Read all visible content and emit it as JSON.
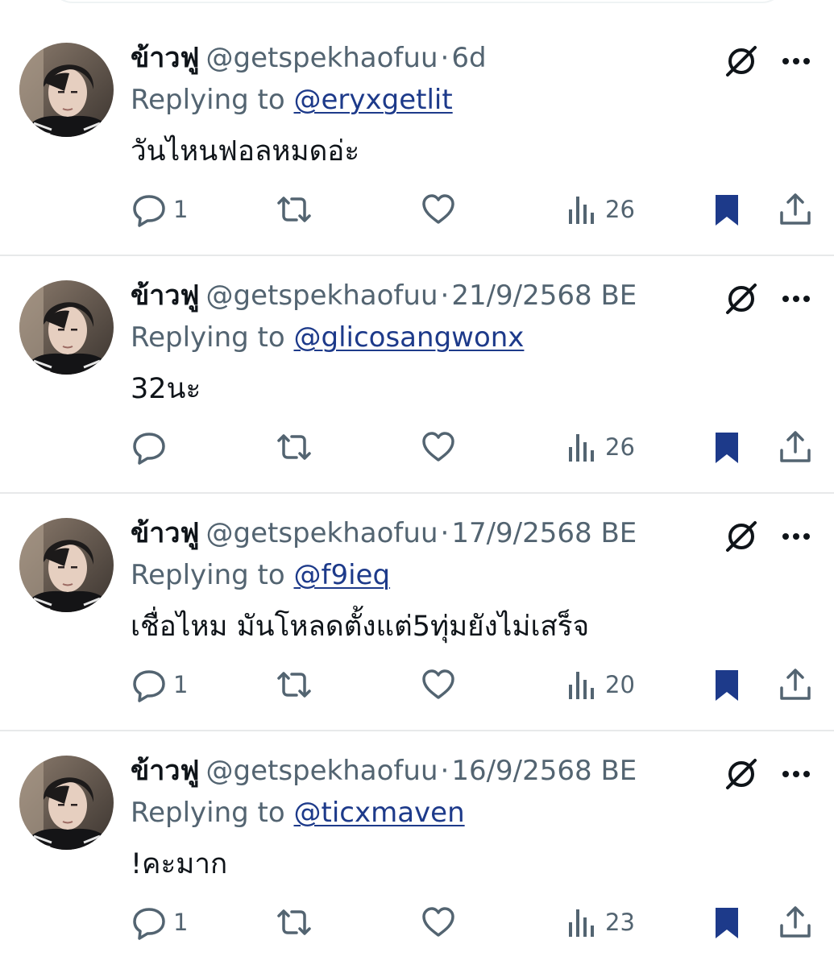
{
  "colors": {
    "text": "#0f1419",
    "muted": "#536471",
    "mention": "#1d3a8a",
    "bookmark": "#1d3a8a",
    "divider": "#e7e9ea"
  },
  "icons": {
    "reply": "speech-bubble-icon",
    "retweet": "repost-arrows-icon",
    "like": "heart-icon",
    "views": "bar-chart-icon",
    "bookmark": "bookmark-filled-icon",
    "share": "share-upload-icon",
    "grok": "grok-slash-circle-icon",
    "more": "three-dots-icon"
  },
  "tweets": [
    {
      "display_name": "ข้าวฟู",
      "handle": "@getspekhaofuu",
      "separator": "·",
      "time": "6d",
      "replying_prefix": "Replying to",
      "replying_to": "@eryxgetlit",
      "text": "วันไหนฟอลหมดอ่ะ",
      "reply_count": "1",
      "view_count": "26",
      "bookmarked": true
    },
    {
      "display_name": "ข้าวฟู",
      "handle": "@getspekhaofuu",
      "separator": "·",
      "time": "21/9/2568 BE",
      "replying_prefix": "Replying to",
      "replying_to": "@glicosangwonx",
      "text": "32นะ",
      "reply_count": "",
      "view_count": "26",
      "bookmarked": true
    },
    {
      "display_name": "ข้าวฟู",
      "handle": "@getspekhaofuu",
      "separator": "·",
      "time": "17/9/2568 BE",
      "replying_prefix": "Replying to",
      "replying_to": "@f9ieq",
      "text": "เชื่อไหม มันโหลดตั้งแต่5ทุ่มยังไม่เสร็จ",
      "reply_count": "1",
      "view_count": "20",
      "bookmarked": true
    },
    {
      "display_name": "ข้าวฟู",
      "handle": "@getspekhaofuu",
      "separator": "·",
      "time": "16/9/2568 BE",
      "replying_prefix": "Replying to",
      "replying_to": "@ticxmaven",
      "text": "!คะมาก",
      "reply_count": "1",
      "view_count": "23",
      "bookmarked": true
    }
  ]
}
